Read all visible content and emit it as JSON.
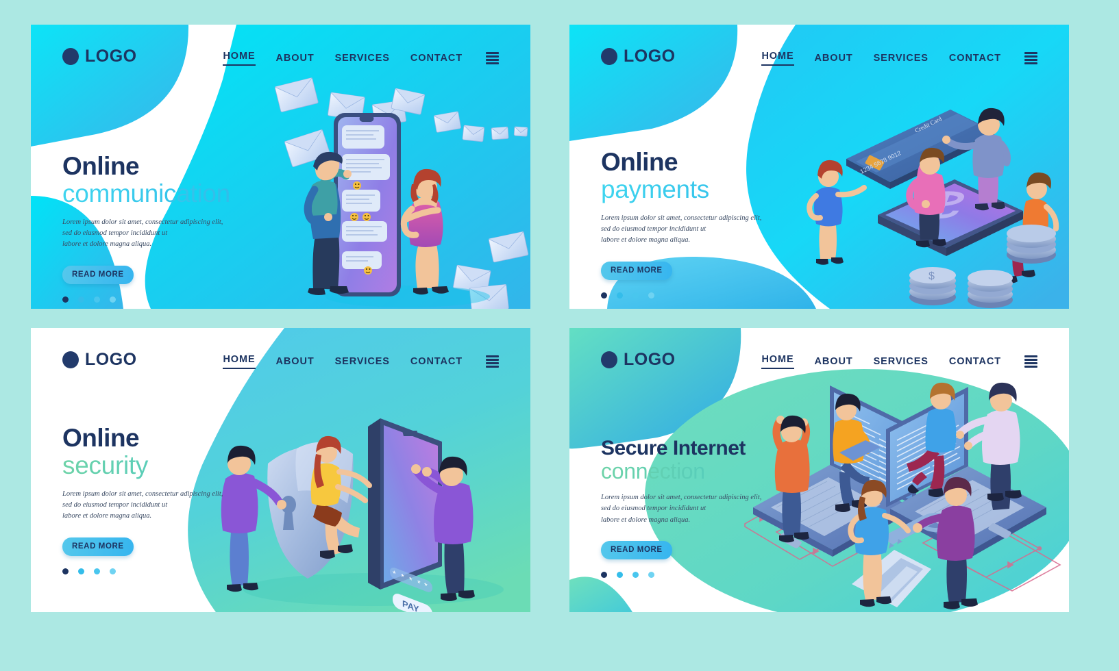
{
  "page": {
    "background": "#ace8e3"
  },
  "common": {
    "logo_text": "LOGO",
    "nav": [
      {
        "label": "HOME",
        "active": true
      },
      {
        "label": "ABOUT",
        "active": false
      },
      {
        "label": "SERVICES",
        "active": false
      },
      {
        "label": "CONTACT",
        "active": false
      }
    ],
    "menu_icon": "hamburger-icon",
    "cta_label": "READ MORE",
    "lorem": [
      "Lorem ipsum dolor sit amet, consectetur adipiscing elit,",
      "sed do eiusmod tempor incididunt ut",
      "labore et dolore magna aliqua."
    ],
    "dots": [
      "#1d3461",
      "#34bdea",
      "#49c6ee",
      "#6fd3f2"
    ]
  },
  "panels": [
    {
      "id": "online-communication",
      "title_line1": "Online",
      "title_line2": "communication",
      "accent": "#3fd5ef",
      "bg": "#2fd8f4",
      "illustration": "chat-messaging-illustration"
    },
    {
      "id": "online-payments",
      "title_line1": "Online",
      "title_line2": "payments",
      "accent": "#2fb7e8",
      "bg": "#22d3f5",
      "illustration": "credit-card-payment-illustration",
      "card_label": "Credit Card",
      "card_number": "1234  5678  9012"
    },
    {
      "id": "online-security",
      "title_line1": "Online",
      "title_line2": "security",
      "accent": "#6ed3a8",
      "bg": "#63d7c6",
      "illustration": "shield-phone-security-illustration",
      "pay_button_label": "PAY"
    },
    {
      "id": "secure-internet-connection",
      "title_line1": "Secure Internet",
      "title_line2": "connection",
      "accent": "#6ed3a8",
      "bg": "#5fd5b8",
      "illustration": "laptops-network-key-illustration"
    }
  ]
}
